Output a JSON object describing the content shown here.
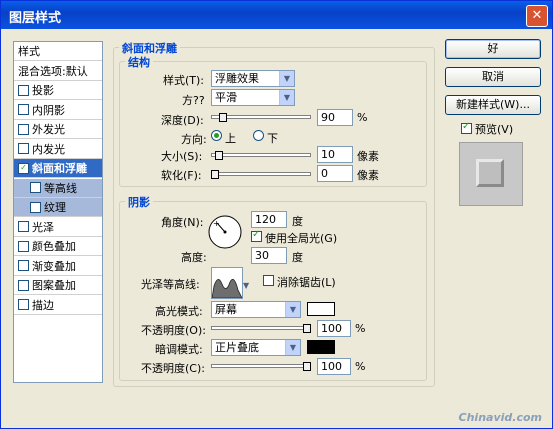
{
  "window": {
    "title": "图层样式",
    "close_glyph": "✕"
  },
  "left_panel": {
    "items": [
      {
        "label": "样式",
        "checkbox": false
      },
      {
        "label": "混合选项:默认",
        "checkbox": false
      },
      {
        "label": "投影",
        "checkbox": true,
        "checked": false
      },
      {
        "label": "内阴影",
        "checkbox": true,
        "checked": false
      },
      {
        "label": "外发光",
        "checkbox": true,
        "checked": false
      },
      {
        "label": "内发光",
        "checkbox": true,
        "checked": false
      },
      {
        "label": "斜面和浮雕",
        "checkbox": true,
        "checked": true,
        "selected": true
      },
      {
        "label": "等高线",
        "checkbox": true,
        "checked": false,
        "sub": true
      },
      {
        "label": "纹理",
        "checkbox": true,
        "checked": false,
        "sub": true
      },
      {
        "label": "光泽",
        "checkbox": true,
        "checked": false
      },
      {
        "label": "颜色叠加",
        "checkbox": true,
        "checked": false
      },
      {
        "label": "渐变叠加",
        "checkbox": true,
        "checked": false
      },
      {
        "label": "图案叠加",
        "checkbox": true,
        "checked": false
      },
      {
        "label": "描边",
        "checkbox": true,
        "checked": false
      }
    ]
  },
  "bevel": {
    "group_title": "斜面和浮雕",
    "structure": {
      "title": "结构",
      "style_label": "样式(T):",
      "style_value": "浮雕效果",
      "method_label": "方??",
      "method_value": "平滑",
      "depth_label": "深度(D):",
      "depth_value": "90",
      "depth_unit": "%",
      "depth_level": 0.09,
      "direction_label": "方向:",
      "direction_up": "上",
      "direction_down": "下",
      "size_label": "大小(S):",
      "size_value": "10",
      "size_unit": "像素",
      "size_level": 0.04,
      "soften_label": "软化(F):",
      "soften_value": "0",
      "soften_unit": "像素",
      "soften_level": 0.0
    },
    "shading": {
      "title": "阴影",
      "angle_label": "角度(N):",
      "angle_value": "120",
      "angle_unit": "度",
      "global_light_label": "使用全局光(G)",
      "global_light_checked": true,
      "altitude_label": "高度:",
      "altitude_value": "30",
      "altitude_unit": "度",
      "gloss_label": "光泽等高线:",
      "antialias_label": "消除锯齿(L)",
      "antialias_checked": false,
      "highlight_mode_label": "高光模式:",
      "highlight_mode_value": "屏幕",
      "highlight_color": "#FFFFFF",
      "highlight_opacity_label": "不透明度(O):",
      "highlight_opacity_value": "100",
      "highlight_opacity_unit": "%",
      "highlight_opacity_level": 1.0,
      "shadow_mode_label": "暗调模式:",
      "shadow_mode_value": "正片叠底",
      "shadow_color": "#000000",
      "shadow_opacity_label": "不透明度(C):",
      "shadow_opacity_value": "100",
      "shadow_opacity_unit": "%",
      "shadow_opacity_level": 1.0
    }
  },
  "buttons": {
    "ok": "好",
    "cancel": "取消",
    "new_style": "新建样式(W)...",
    "preview_label": "预览(V)",
    "preview_checked": true
  },
  "watermark": "Chinavid.com"
}
